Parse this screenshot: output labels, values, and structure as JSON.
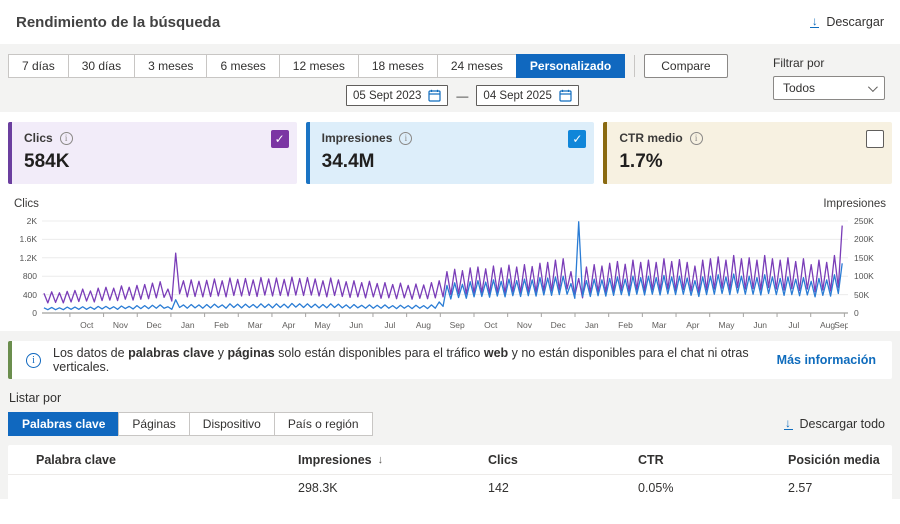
{
  "header": {
    "title": "Rendimiento de la búsqueda",
    "download_label": "Descargar"
  },
  "toolbar": {
    "ranges": [
      "7 días",
      "30 días",
      "3 meses",
      "6 meses",
      "12 meses",
      "18 meses",
      "24 meses",
      "Personalizado"
    ],
    "active_range": "Personalizado",
    "compare_label": "Compare",
    "date_from": "05 Sept 2023",
    "date_separator": "—",
    "date_to": "04 Sept 2025",
    "filter_label": "Filtrar por",
    "filter_value": "Todos"
  },
  "cards": [
    {
      "label": "Clics",
      "value": "584K",
      "checked": true,
      "accent": "#6b3f9f",
      "check_color": "#7b35a3",
      "bg": "#f2ecf9"
    },
    {
      "label": "Impresiones",
      "value": "34.4M",
      "checked": true,
      "accent": "#1b74c4",
      "check_color": "#1086d9",
      "bg": "#ddeefa"
    },
    {
      "label": "CTR medio",
      "value": "1.7%",
      "checked": false,
      "accent": "#8a6a11",
      "check_color": "#ffffff",
      "bg": "#f7f1e1"
    }
  ],
  "chart_data": {
    "type": "line",
    "left_axis": {
      "label": "Clics",
      "ticks": [
        "2K",
        "1.6K",
        "1.2K",
        "800",
        "400",
        "0"
      ],
      "max": 2000
    },
    "right_axis": {
      "label": "Impresiones",
      "ticks": [
        "250K",
        "200K",
        "150K",
        "100K",
        "50K",
        "0"
      ],
      "max": 250,
      "unit": "thousands"
    },
    "x_labels": [
      "Oct",
      "Nov",
      "Dec",
      "Jan",
      "Feb",
      "Mar",
      "Apr",
      "May",
      "Jun",
      "Jul",
      "Aug",
      "Sep",
      "Oct",
      "Nov",
      "Dec",
      "Jan",
      "Feb",
      "Mar",
      "Apr",
      "May",
      "Jun",
      "Jul",
      "Aug",
      "Sep"
    ],
    "x_range": "05 Sept 2023 - 04 Sept 2025, weekly resolution",
    "grid": "horizontal",
    "legend_position": "none",
    "series": [
      {
        "name": "Clics",
        "axis": "left",
        "color": "#7a3db8",
        "weekly_peaks": [
          430,
          460,
          440,
          470,
          490,
          520,
          480,
          540,
          560,
          540,
          590,
          560,
          600,
          620,
          650,
          680,
          520,
          1300,
          700,
          720,
          690,
          710,
          740,
          700,
          760,
          730,
          750,
          720,
          770,
          740,
          760,
          730,
          780,
          750,
          770,
          740,
          700,
          760,
          720,
          680,
          700,
          660,
          690,
          640,
          660,
          620,
          650,
          600,
          630,
          610,
          660,
          700,
          900,
          950,
          920,
          980,
          1000,
          960,
          1020,
          980,
          1040,
          1000,
          1050,
          1010,
          1080,
          1100,
          1150,
          1180,
          900,
          750,
          1000,
          1050,
          1020,
          1080,
          1120,
          1060,
          1150,
          1100,
          1150,
          1100,
          1180,
          1120,
          1160,
          1100,
          1020,
          1150,
          1180,
          1220,
          1150,
          1250,
          1180,
          1200,
          1150,
          1250,
          1180,
          1150,
          1200,
          1120,
          1180,
          1050,
          1150,
          1100,
          1250,
          1900
        ],
        "weekly_troughs": [
          220,
          230,
          220,
          240,
          250,
          260,
          240,
          270,
          280,
          270,
          300,
          280,
          300,
          310,
          330,
          340,
          260,
          420,
          350,
          360,
          350,
          360,
          370,
          350,
          380,
          370,
          380,
          360,
          390,
          370,
          380,
          370,
          390,
          380,
          390,
          370,
          350,
          380,
          360,
          340,
          350,
          330,
          350,
          320,
          330,
          310,
          330,
          300,
          320,
          310,
          330,
          350,
          400,
          420,
          410,
          430,
          440,
          420,
          450,
          430,
          460,
          440,
          460,
          450,
          480,
          480,
          500,
          520,
          380,
          330,
          440,
          460,
          450,
          470,
          490,
          470,
          500,
          480,
          500,
          480,
          520,
          490,
          510,
          480,
          450,
          500,
          520,
          540,
          500,
          550,
          520,
          530,
          500,
          550,
          520,
          500,
          530,
          490,
          520,
          460,
          500,
          480,
          550,
          700
        ]
      },
      {
        "name": "Impresiones",
        "axis": "right",
        "color": "#2a7cd4",
        "weekly_peaks": [
          14,
          15,
          14,
          16,
          16,
          17,
          16,
          18,
          18,
          17,
          19,
          18,
          20,
          20,
          21,
          22,
          17,
          36,
          22,
          23,
          22,
          23,
          24,
          22,
          25,
          24,
          24,
          23,
          25,
          24,
          25,
          24,
          26,
          25,
          25,
          24,
          23,
          25,
          24,
          22,
          23,
          21,
          22,
          21,
          22,
          20,
          21,
          20,
          21,
          20,
          22,
          30,
          75,
          82,
          78,
          85,
          88,
          84,
          90,
          86,
          92,
          88,
          92,
          90,
          96,
          95,
          98,
          100,
          80,
          248,
          88,
          92,
          90,
          94,
          98,
          92,
          100,
          96,
          100,
          96,
          102,
          98,
          100,
          95,
          88,
          98,
          100,
          104,
          98,
          106,
          100,
          100,
          96,
          104,
          98,
          94,
          98,
          92,
          96,
          86,
          94,
          90,
          104,
          135
        ],
        "weekly_troughs": [
          9,
          9,
          9,
          10,
          10,
          10,
          10,
          11,
          11,
          10,
          12,
          11,
          12,
          12,
          13,
          13,
          10,
          15,
          13,
          14,
          13,
          14,
          15,
          13,
          15,
          14,
          15,
          14,
          15,
          14,
          15,
          14,
          16,
          15,
          15,
          14,
          14,
          15,
          14,
          13,
          14,
          13,
          13,
          13,
          13,
          12,
          13,
          12,
          13,
          12,
          13,
          18,
          38,
          42,
          40,
          44,
          45,
          43,
          46,
          44,
          47,
          45,
          47,
          46,
          49,
          48,
          50,
          51,
          40,
          45,
          45,
          47,
          46,
          48,
          50,
          47,
          51,
          49,
          51,
          49,
          52,
          50,
          51,
          48,
          45,
          50,
          51,
          53,
          50,
          54,
          51,
          51,
          49,
          53,
          50,
          48,
          50,
          47,
          49,
          44,
          48,
          46,
          53,
          70
        ]
      }
    ]
  },
  "banner": {
    "segments": [
      {
        "t": "Los datos de ",
        "b": false
      },
      {
        "t": "palabras clave",
        "b": true
      },
      {
        "t": " y ",
        "b": false
      },
      {
        "t": "páginas",
        "b": true
      },
      {
        "t": " solo están disponibles para el tráfico ",
        "b": false
      },
      {
        "t": "web",
        "b": true
      },
      {
        "t": " y no están disponibles para el chat ni otras verticales.",
        "b": false
      }
    ],
    "link_label": "Más información"
  },
  "list_section": {
    "label": "Listar por",
    "tabs": [
      "Palabras clave",
      "Páginas",
      "Dispositivo",
      "País o región"
    ],
    "active_tab": "Palabras clave",
    "download_all_label": "Descargar todo"
  },
  "table": {
    "columns": [
      "Palabra clave",
      "Impresiones",
      "Clics",
      "CTR",
      "Posición media"
    ],
    "sort_column": "Impresiones",
    "sort_direction": "desc",
    "rows": [
      {
        "keyword": "",
        "impressions": "298.3K",
        "clicks": "142",
        "ctr": "0.05%",
        "position": "2.57"
      }
    ]
  }
}
